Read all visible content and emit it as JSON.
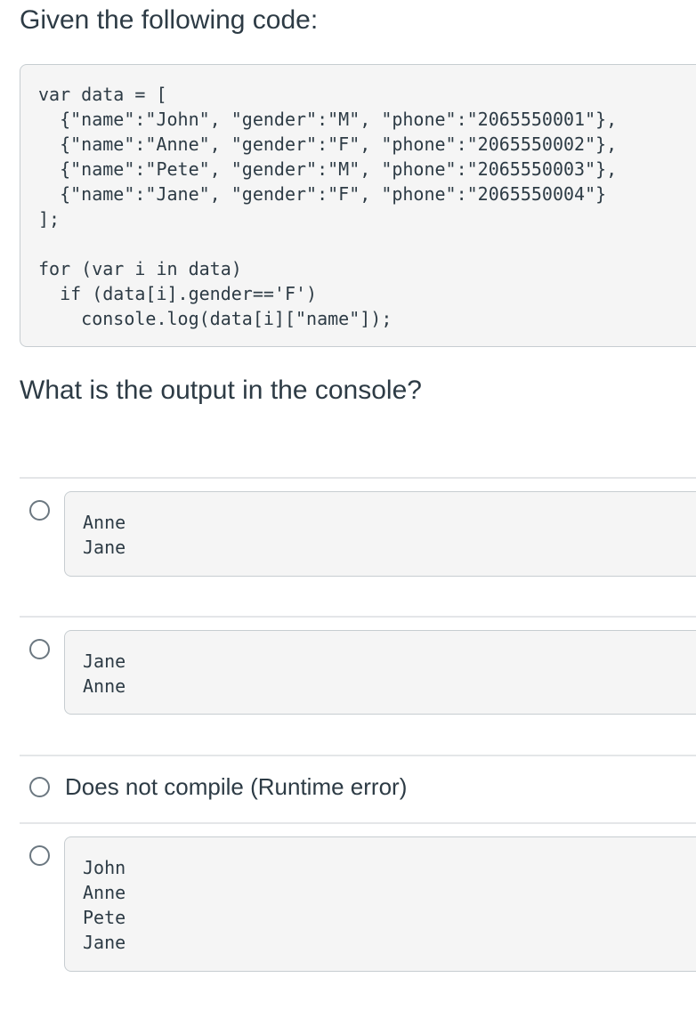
{
  "prompt": {
    "heading": "Given the following code:",
    "code": "var data = [\n  {\"name\":\"John\", \"gender\":\"M\", \"phone\":\"2065550001\"},\n  {\"name\":\"Anne\", \"gender\":\"F\", \"phone\":\"2065550002\"},\n  {\"name\":\"Pete\", \"gender\":\"M\", \"phone\":\"2065550003\"},\n  {\"name\":\"Jane\", \"gender\":\"F\", \"phone\":\"2065550004\"}\n];\n\nfor (var i in data)\n  if (data[i].gender=='F')\n    console.log(data[i][\"name\"]);"
  },
  "question": "What is the output in the console?",
  "options": [
    {
      "type": "code",
      "text": "Anne\nJane"
    },
    {
      "type": "code",
      "text": "Jane\nAnne"
    },
    {
      "type": "text",
      "text": "Does not compile (Runtime error)"
    },
    {
      "type": "code",
      "text": "John\nAnne\nPete\nJane"
    }
  ],
  "colors": {
    "text": "#2d3b45",
    "code_background": "#f5f5f5",
    "border": "#c7cdd1",
    "separator": "#e4e6e8",
    "radio_border": "#6b7780"
  }
}
